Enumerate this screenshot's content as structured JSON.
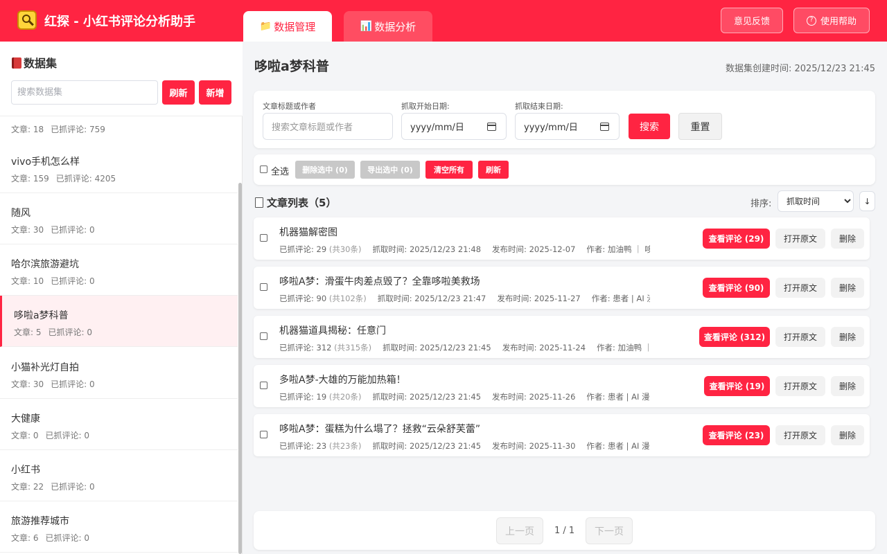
{
  "header": {
    "app_title": "红探 - 小红书评论分析助手",
    "tabs": [
      {
        "label": "数据管理",
        "icon": "folder-icon",
        "active": true
      },
      {
        "label": "数据分析",
        "icon": "bar-chart-icon",
        "active": false
      }
    ],
    "feedback_label": "意见反馈",
    "help_label": "使用帮助",
    "accent_color": "#ff2442"
  },
  "sidebar": {
    "title": "数据集",
    "search_placeholder": "搜索数据集",
    "refresh_label": "刷新",
    "new_label": "新增",
    "items": [
      {
        "name": "",
        "articles": "文章: 18",
        "comments": "已抓评论: 759"
      },
      {
        "name": "vivo手机怎么样",
        "articles": "文章: 159",
        "comments": "已抓评论: 4205"
      },
      {
        "name": "随风",
        "articles": "文章: 30",
        "comments": "已抓评论: 0"
      },
      {
        "name": "哈尔滨旅游避坑",
        "articles": "文章: 10",
        "comments": "已抓评论: 0"
      },
      {
        "name": "哆啦a梦科普",
        "articles": "文章: 5",
        "comments": "已抓评论: 0",
        "active": true
      },
      {
        "name": "小猫补光灯自拍",
        "articles": "文章: 30",
        "comments": "已抓评论: 0"
      },
      {
        "name": "大健康",
        "articles": "文章: 0",
        "comments": "已抓评论: 0"
      },
      {
        "name": "小红书",
        "articles": "文章: 22",
        "comments": "已抓评论: 0"
      },
      {
        "name": "旅游推荐城市",
        "articles": "文章: 6",
        "comments": "已抓评论: 0"
      }
    ]
  },
  "main": {
    "title": "哆啦a梦科普",
    "created_at": "数据集创建时间: 2025/12/23 21:45",
    "filter": {
      "keyword_label": "文章标题或作者",
      "keyword_placeholder": "搜索文章标题或作者",
      "start_label": "抓取开始日期:",
      "start_value": "yyyy/mm/日",
      "end_label": "抓取结束日期:",
      "end_value": "yyyy/mm/日",
      "search_label": "搜索",
      "reset_label": "重置"
    },
    "toolbar": {
      "select_all": "全选",
      "delete_selected": "删除选中 (0)",
      "export_selected": "导出选中 (0)",
      "clear_all": "清空所有",
      "refresh": "刷新"
    },
    "list_title": "文章列表（5）",
    "sort_label": "排序:",
    "sort_value": "抓取时间",
    "sort_direction": "↓",
    "articles": [
      {
        "title": "机器猫解密图",
        "fetched": "已抓评论: 29",
        "total": "(共30条)",
        "crawl_time": "抓取时间: 2025/12/23 21:48",
        "publish_time": "发布时间: 2025-12-07",
        "author": "作者: 加油鸭 ｜ 哆...",
        "view_label": "查看评论 (29)",
        "open_label": "打开原文",
        "delete_label": "删除"
      },
      {
        "title": "哆啦A梦：滑蛋牛肉差点毁了？全靠哆啦美救场",
        "fetched": "已抓评论: 90",
        "total": "(共102条)",
        "crawl_time": "抓取时间: 2025/12/23 21:47",
        "publish_time": "发布时间: 2025-11-27",
        "author": "作者: 患者 | AI 漫...",
        "view_label": "查看评论 (90)",
        "open_label": "打开原文",
        "delete_label": "删除"
      },
      {
        "title": "机器猫道具揭秘：任意门",
        "fetched": "已抓评论: 312",
        "total": "(共315条)",
        "crawl_time": "抓取时间: 2025/12/23 21:45",
        "publish_time": "发布时间: 2025-11-24",
        "author": "作者: 加油鸭 ｜ 哆...",
        "view_label": "查看评论 (312)",
        "open_label": "打开原文",
        "delete_label": "删除"
      },
      {
        "title": "多啦A梦-大雄的万能加热箱！",
        "fetched": "已抓评论: 19",
        "total": "(共20条)",
        "crawl_time": "抓取时间: 2025/12/23 21:45",
        "publish_time": "发布时间: 2025-11-26",
        "author": "作者: 患者 | AI 漫...",
        "view_label": "查看评论 (19)",
        "open_label": "打开原文",
        "delete_label": "删除"
      },
      {
        "title": "哆啦A梦：蛋糕为什么塌了？拯救“云朵舒芙蕾”",
        "fetched": "已抓评论: 23",
        "total": "(共23条)",
        "crawl_time": "抓取时间: 2025/12/23 21:45",
        "publish_time": "发布时间: 2025-11-30",
        "author": "作者: 患者 | AI 漫...",
        "view_label": "查看评论 (23)",
        "open_label": "打开原文",
        "delete_label": "删除"
      }
    ],
    "pager": {
      "prev_label": "上一页",
      "page_info": "1 / 1",
      "next_label": "下一页"
    }
  }
}
